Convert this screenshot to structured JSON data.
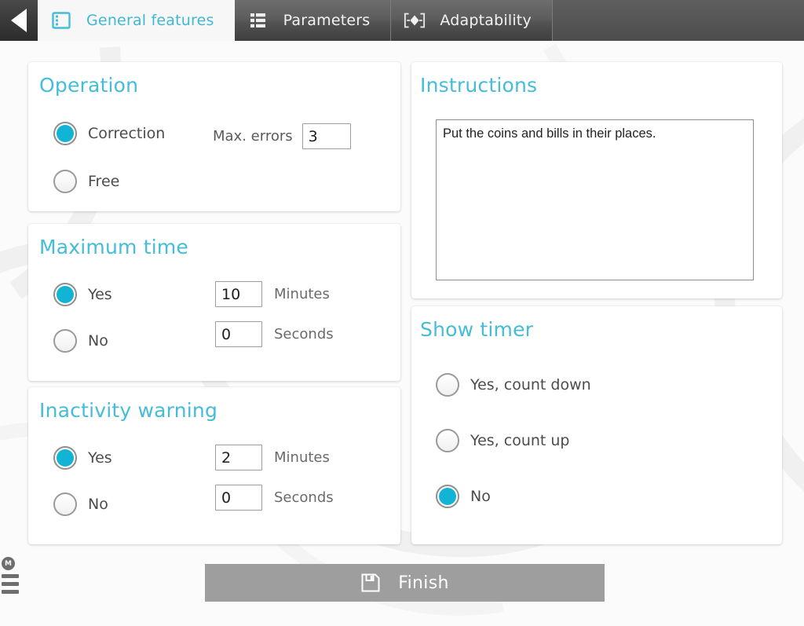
{
  "tabbar": {
    "back_icon": "back-arrow-icon",
    "tabs": [
      {
        "label": "General features",
        "icon": "film-strip-icon",
        "active": true
      },
      {
        "label": "Parameters",
        "icon": "list-grid-icon",
        "active": false
      },
      {
        "label": "Adaptability",
        "icon": "resize-brackets-icon",
        "active": false
      }
    ],
    "active_color": "#3fb8d6"
  },
  "operation": {
    "title": "Operation",
    "options": [
      {
        "label": "Correction",
        "selected": true
      },
      {
        "label": "Free",
        "selected": false
      }
    ],
    "max_errors_label": "Max. errors",
    "max_errors_value": "3"
  },
  "maximum_time": {
    "title": "Maximum time",
    "options": [
      {
        "label": "Yes",
        "selected": true
      },
      {
        "label": "No",
        "selected": false
      }
    ],
    "minutes_value": "10",
    "minutes_label": "Minutes",
    "seconds_value": "0",
    "seconds_label": "Seconds"
  },
  "inactivity_warning": {
    "title": "Inactivity warning",
    "options": [
      {
        "label": "Yes",
        "selected": true
      },
      {
        "label": "No",
        "selected": false
      }
    ],
    "minutes_value": "2",
    "minutes_label": "Minutes",
    "seconds_value": "0",
    "seconds_label": "Seconds"
  },
  "instructions": {
    "title": "Instructions",
    "text": "Put the coins and bills in their places.",
    "placeholder": ""
  },
  "show_timer": {
    "title": "Show timer",
    "options": [
      {
        "label": "Yes, count down",
        "selected": false
      },
      {
        "label": "Yes, count up",
        "selected": false
      },
      {
        "label": "No",
        "selected": true
      }
    ]
  },
  "footer": {
    "finish_label": "Finish",
    "finish_icon": "save-floppy-icon",
    "brand_badge": "M",
    "menu_icon": "hamburger-menu-icon"
  },
  "theme": {
    "accent": "#45bcd8",
    "radio_fill": "#11b4d4",
    "page_bg": "#fbfbfb",
    "button_bg": "#9e9e9e"
  }
}
